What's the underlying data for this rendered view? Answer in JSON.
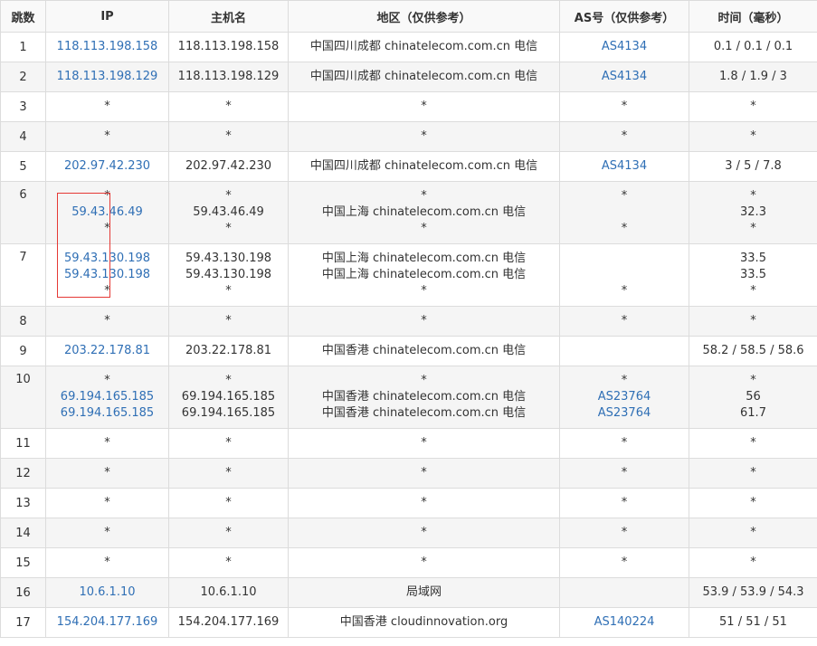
{
  "headers": [
    "跳数",
    "IP",
    "主机名",
    "地区（仅供参考）",
    "AS号（仅供参考）",
    "时间（毫秒）"
  ],
  "rows": [
    {
      "hop": "1",
      "ip": [
        "118.113.198.158"
      ],
      "host": [
        "118.113.198.158"
      ],
      "region": [
        "中国四川成都 chinatelecom.com.cn 电信"
      ],
      "as": [
        "AS4134"
      ],
      "time": [
        "0.1 / 0.1 / 0.1"
      ]
    },
    {
      "hop": "2",
      "ip": [
        "118.113.198.129"
      ],
      "host": [
        "118.113.198.129"
      ],
      "region": [
        "中国四川成都 chinatelecom.com.cn 电信"
      ],
      "as": [
        "AS4134"
      ],
      "time": [
        "1.8 / 1.9 / 3"
      ]
    },
    {
      "hop": "3",
      "ip": [
        "*"
      ],
      "host": [
        "*"
      ],
      "region": [
        "*"
      ],
      "as": [
        "*"
      ],
      "time": [
        "*"
      ]
    },
    {
      "hop": "4",
      "ip": [
        "*"
      ],
      "host": [
        "*"
      ],
      "region": [
        "*"
      ],
      "as": [
        "*"
      ],
      "time": [
        "*"
      ]
    },
    {
      "hop": "5",
      "ip": [
        "202.97.42.230"
      ],
      "host": [
        "202.97.42.230"
      ],
      "region": [
        "中国四川成都 chinatelecom.com.cn 电信"
      ],
      "as": [
        "AS4134"
      ],
      "time": [
        "3 / 5 / 7.8"
      ]
    },
    {
      "hop": "6",
      "ip": [
        "*",
        "59.43.46.49",
        "*"
      ],
      "host": [
        "*",
        "59.43.46.49",
        "*"
      ],
      "region": [
        "*",
        "中国上海 chinatelecom.com.cn 电信",
        "*"
      ],
      "as": [
        "*",
        "",
        "*"
      ],
      "time": [
        "*",
        "32.3",
        "*"
      ]
    },
    {
      "hop": "7",
      "ip": [
        "59.43.130.198",
        "59.43.130.198",
        "*"
      ],
      "host": [
        "59.43.130.198",
        "59.43.130.198",
        "*"
      ],
      "region": [
        "中国上海 chinatelecom.com.cn 电信",
        "中国上海 chinatelecom.com.cn 电信",
        "*"
      ],
      "as": [
        "",
        "",
        "*"
      ],
      "time": [
        "33.5",
        "33.5",
        "*"
      ]
    },
    {
      "hop": "8",
      "ip": [
        "*"
      ],
      "host": [
        "*"
      ],
      "region": [
        "*"
      ],
      "as": [
        "*"
      ],
      "time": [
        "*"
      ]
    },
    {
      "hop": "9",
      "ip": [
        "203.22.178.81"
      ],
      "host": [
        "203.22.178.81"
      ],
      "region": [
        "中国香港 chinatelecom.com.cn 电信"
      ],
      "as": [
        ""
      ],
      "time": [
        "58.2 / 58.5 / 58.6"
      ]
    },
    {
      "hop": "10",
      "ip": [
        "*",
        "69.194.165.185",
        "69.194.165.185"
      ],
      "host": [
        "*",
        "69.194.165.185",
        "69.194.165.185"
      ],
      "region": [
        "*",
        "中国香港 chinatelecom.com.cn 电信",
        "中国香港 chinatelecom.com.cn 电信"
      ],
      "as": [
        "*",
        "AS23764",
        "AS23764"
      ],
      "time": [
        "*",
        "56",
        "61.7"
      ]
    },
    {
      "hop": "11",
      "ip": [
        "*"
      ],
      "host": [
        "*"
      ],
      "region": [
        "*"
      ],
      "as": [
        "*"
      ],
      "time": [
        "*"
      ]
    },
    {
      "hop": "12",
      "ip": [
        "*"
      ],
      "host": [
        "*"
      ],
      "region": [
        "*"
      ],
      "as": [
        "*"
      ],
      "time": [
        "*"
      ]
    },
    {
      "hop": "13",
      "ip": [
        "*"
      ],
      "host": [
        "*"
      ],
      "region": [
        "*"
      ],
      "as": [
        "*"
      ],
      "time": [
        "*"
      ]
    },
    {
      "hop": "14",
      "ip": [
        "*"
      ],
      "host": [
        "*"
      ],
      "region": [
        "*"
      ],
      "as": [
        "*"
      ],
      "time": [
        "*"
      ]
    },
    {
      "hop": "15",
      "ip": [
        "*"
      ],
      "host": [
        "*"
      ],
      "region": [
        "*"
      ],
      "as": [
        "*"
      ],
      "time": [
        "*"
      ]
    },
    {
      "hop": "16",
      "ip": [
        "10.6.1.10"
      ],
      "host": [
        "10.6.1.10"
      ],
      "region": [
        "局域网"
      ],
      "as": [
        ""
      ],
      "time": [
        "53.9 / 53.9 / 54.3"
      ]
    },
    {
      "hop": "17",
      "ip": [
        "154.204.177.169"
      ],
      "host": [
        "154.204.177.169"
      ],
      "region": [
        "中国香港 cloudinnovation.org"
      ],
      "as": [
        "AS140224"
      ],
      "time": [
        "51 / 51 / 51"
      ]
    }
  ],
  "colors": {
    "link": "#2f6fb5",
    "highlight": "#e53935",
    "border": "#dcdcdc"
  }
}
